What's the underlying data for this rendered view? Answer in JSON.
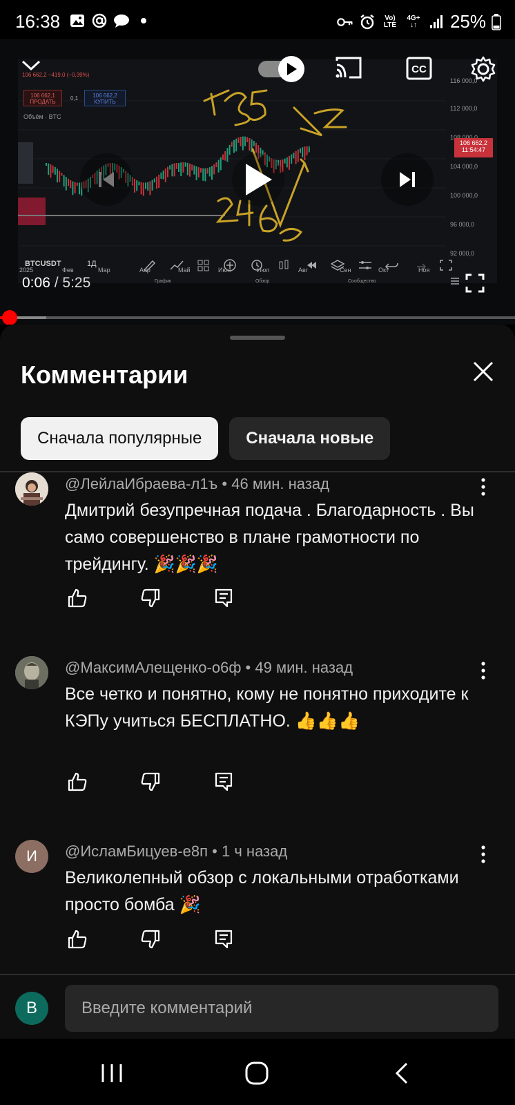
{
  "status_bar": {
    "time": "16:38",
    "battery": "25%",
    "network_top": "Vo)",
    "network_bottom": "LTE",
    "data_type": "4G+",
    "left_icons": [
      "gallery-icon",
      "at-icon",
      "chat-bubble-icon",
      "dot-icon"
    ],
    "right_icons": [
      "key-icon",
      "alarm-icon",
      "volte-icon",
      "4g-icon",
      "signal-icon",
      "battery-icon"
    ]
  },
  "video": {
    "current_time": "0:06",
    "separator": " / ",
    "duration": "5:25",
    "progress_fraction": 0.0185,
    "buffered_fraction": 0.09,
    "overlay_icons": [
      "collapse-chevron-icon",
      "autoplay-toggle-icon",
      "cast-icon",
      "captions-icon",
      "settings-gear-icon",
      "previous-icon",
      "play-icon",
      "next-icon",
      "fullscreen-icon"
    ],
    "chart": {
      "top_info": "106 662,2 −419,0 (−0,39%)",
      "sell_price": "106 662,1",
      "sell_label": "ПРОДАТЬ",
      "spread": "0,1",
      "buy_price": "106 662,2",
      "buy_label": "КУПИТЬ",
      "volume_label": "Объём · BTC",
      "price_ticks": [
        "116 000,0",
        "112 000,0",
        "108 000,0",
        "104 000,0",
        "100 000,0",
        "96 000,0",
        "92 000,0"
      ],
      "current_price": "106 662,2",
      "countdown": "11:54:47",
      "months": [
        "2025",
        "Фев",
        "Мар",
        "Апр",
        "Май",
        "Июн",
        "Июл",
        "Авг",
        "Сен",
        "Окт",
        "Ноя"
      ],
      "ticker": "BTCUSDT",
      "timeframe": "1Д",
      "tab_chart": "График",
      "tab_overview": "Обзор",
      "tab_community": "Сообщество",
      "handwritten": [
        "135",
        "Z",
        "246"
      ]
    }
  },
  "comments_panel": {
    "title": "Комментарии",
    "sort_chips": [
      {
        "label": "Сначала популярные",
        "active": true
      },
      {
        "label": "Сначала новые",
        "active": false
      }
    ],
    "comments": [
      {
        "author": "@ЛейлаИбраева-л1ъ",
        "time": "46 мин. назад",
        "text": "Дмитрий безупречная подача . Благодарность . Вы само совершенство в плане грамотности  по трейдингу. 🎉🎉🎉",
        "avatar_letter": "",
        "avatar_color": "#d8d0c8"
      },
      {
        "author": "@МаксимАлещенко-о6ф",
        "time": "49 мин. назад",
        "text": "Все четко и понятно, кому не понятно приходите к КЭПу учиться БЕСПЛАТНО. 👍👍👍",
        "avatar_letter": "",
        "avatar_color": "#7a7a6a"
      },
      {
        "author": "@ИсламБицуев-е8п",
        "time": "1 ч назад",
        "text": "Великолепный обзор с локальными отработками просто бомба 🎉",
        "avatar_letter": "И",
        "avatar_color": "#8d6e63"
      }
    ],
    "meta_separator": " • "
  },
  "input_bar": {
    "avatar_letter": "В",
    "placeholder": "Введите комментарий"
  },
  "colors": {
    "accent_red": "#ff0000",
    "panel_bg": "#0f0f0f",
    "chip_active_bg": "#f1f1f1",
    "chip_inactive_bg": "#272727",
    "input_avatar": "#0c6b5d"
  },
  "navbar": {
    "icons": [
      "recent-apps-icon",
      "home-icon",
      "back-icon"
    ]
  }
}
